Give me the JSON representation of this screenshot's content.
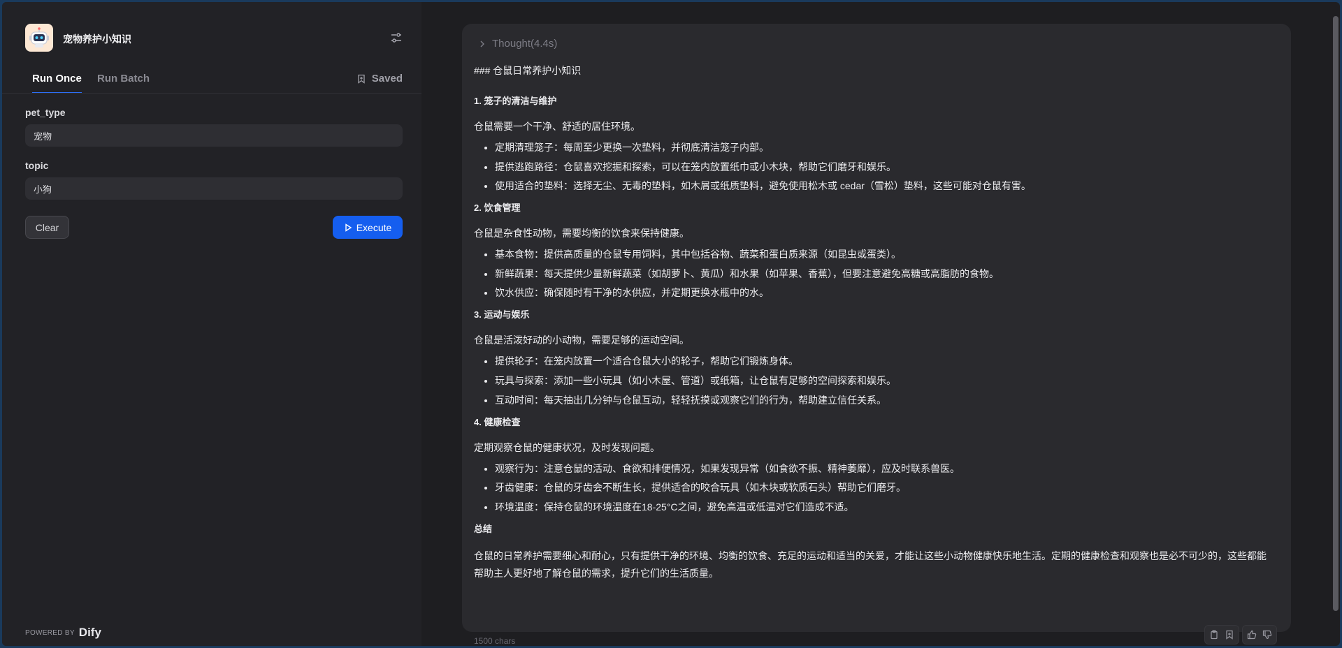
{
  "app": {
    "title": "宠物养护小知识",
    "logo_icon": "robot-icon"
  },
  "tabs": {
    "run_once": "Run Once",
    "run_batch": "Run Batch",
    "saved": "Saved"
  },
  "form": {
    "fields": [
      {
        "label": "pet_type",
        "value": "宠物"
      },
      {
        "label": "topic",
        "value": "小狗"
      }
    ],
    "clear_label": "Clear",
    "execute_label": "Execute"
  },
  "footer": {
    "powered_by": "POWERED BY",
    "brand": "Dify"
  },
  "result": {
    "thought_label": "Thought(4.4s)",
    "heading": "### 仓鼠日常养护小知识",
    "sections": [
      {
        "title": "1. 笼子的清洁与维护",
        "intro": "仓鼠需要一个干净、舒适的居住环境。",
        "items": [
          "定期清理笼子：每周至少更换一次垫料，并彻底清洁笼子内部。",
          "提供逃跑路径：仓鼠喜欢挖掘和探索，可以在笼内放置纸巾或小木块，帮助它们磨牙和娱乐。",
          "使用适合的垫料：选择无尘、无毒的垫料，如木屑或纸质垫料，避免使用松木或 cedar（雪松）垫料，这些可能对仓鼠有害。"
        ]
      },
      {
        "title": "2. 饮食管理",
        "intro": "仓鼠是杂食性动物，需要均衡的饮食来保持健康。",
        "items": [
          "基本食物：提供高质量的仓鼠专用饲料，其中包括谷物、蔬菜和蛋白质来源（如昆虫或蛋类）。",
          "新鲜蔬果：每天提供少量新鲜蔬菜（如胡萝卜、黄瓜）和水果（如苹果、香蕉），但要注意避免高糖或高脂肪的食物。",
          "饮水供应：确保随时有干净的水供应，并定期更换水瓶中的水。"
        ]
      },
      {
        "title": "3. 运动与娱乐",
        "intro": "仓鼠是活泼好动的小动物，需要足够的运动空间。",
        "items": [
          "提供轮子：在笼内放置一个适合仓鼠大小的轮子，帮助它们锻炼身体。",
          "玩具与探索：添加一些小玩具（如小木屋、管道）或纸箱，让仓鼠有足够的空间探索和娱乐。",
          "互动时间：每天抽出几分钟与仓鼠互动，轻轻抚摸或观察它们的行为，帮助建立信任关系。"
        ]
      },
      {
        "title": "4. 健康检查",
        "intro": "定期观察仓鼠的健康状况，及时发现问题。",
        "items": [
          "观察行为：注意仓鼠的活动、食欲和排便情况，如果发现异常（如食欲不振、精神萎靡），应及时联系兽医。",
          "牙齿健康：仓鼠的牙齿会不断生长，提供适合的咬合玩具（如木块或软质石头）帮助它们磨牙。",
          "环境温度：保持仓鼠的环境温度在18-25°C之间，避免高温或低温对它们造成不适。"
        ]
      }
    ],
    "summary_title": "总结",
    "summary_text": "仓鼠的日常养护需要细心和耐心，只有提供干净的环境、均衡的饮食、充足的运动和适当的关爱，才能让这些小动物健康快乐地生活。定期的健康检查和观察也是必不可少的，这些都能帮助主人更好地了解仓鼠的需求，提升它们的生活质量。",
    "char_count": "1500 chars"
  },
  "colors": {
    "accent": "#155eef",
    "panel": "#222226",
    "card": "#2a2a2e"
  }
}
